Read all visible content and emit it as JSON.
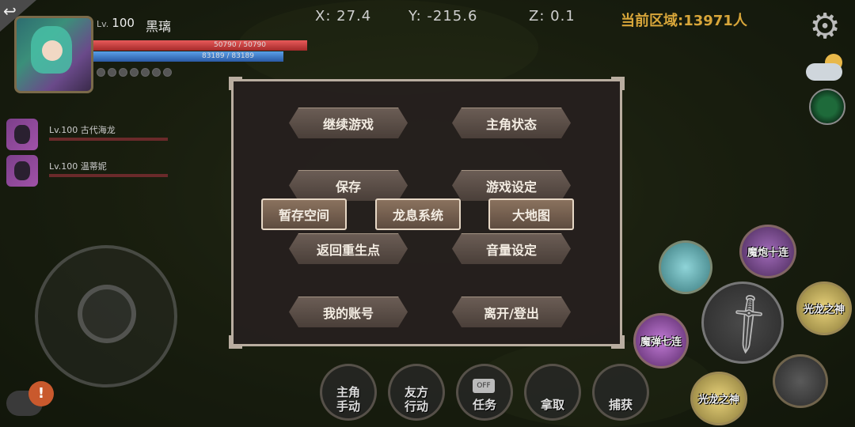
{
  "hud": {
    "back_icon": "back-arrow-icon",
    "player": {
      "lv_prefix": "Lv.",
      "level": "100",
      "name": "黑璃",
      "hp_text": "50790 / 50790",
      "hp_fraction": 1.0,
      "mp_text": "83189 / 83189",
      "mp_fraction": 1.0,
      "hp_color": "#d94545",
      "mp_color": "#4a8ad9"
    },
    "party": [
      {
        "label": "Lv.100 古代海龙"
      },
      {
        "label": "Lv.100 温蒂妮"
      }
    ],
    "coords": {
      "x": "X: 27.4",
      "y": "Y: -215.6",
      "z": "Z: 0.1"
    },
    "region": "当前区域:13971人",
    "region_color": "#d8a63a"
  },
  "menu": {
    "buttons": {
      "continue": "继续游戏",
      "status": "主角状态",
      "save": "保存",
      "settings": "游戏设定",
      "storage": "暂存空间",
      "dragon": "龙息系统",
      "map": "大地图",
      "respawn": "返回重生点",
      "volume": "音量设定",
      "account": "我的账号",
      "logout": "离开/登出"
    }
  },
  "skills": {
    "cannon": "魔炮十连",
    "light_god_right": "光龙之神",
    "bullet": "魔弹七连",
    "light_god_bottom": "光龙之神"
  },
  "bottom_actions": {
    "hero_manual": [
      "主角",
      "手动"
    ],
    "ally_action": [
      "友方",
      "行动"
    ],
    "task_off": "OFF",
    "task": "任务",
    "pickup": "拿取",
    "capture": "捕获"
  },
  "chat_alert": "!"
}
